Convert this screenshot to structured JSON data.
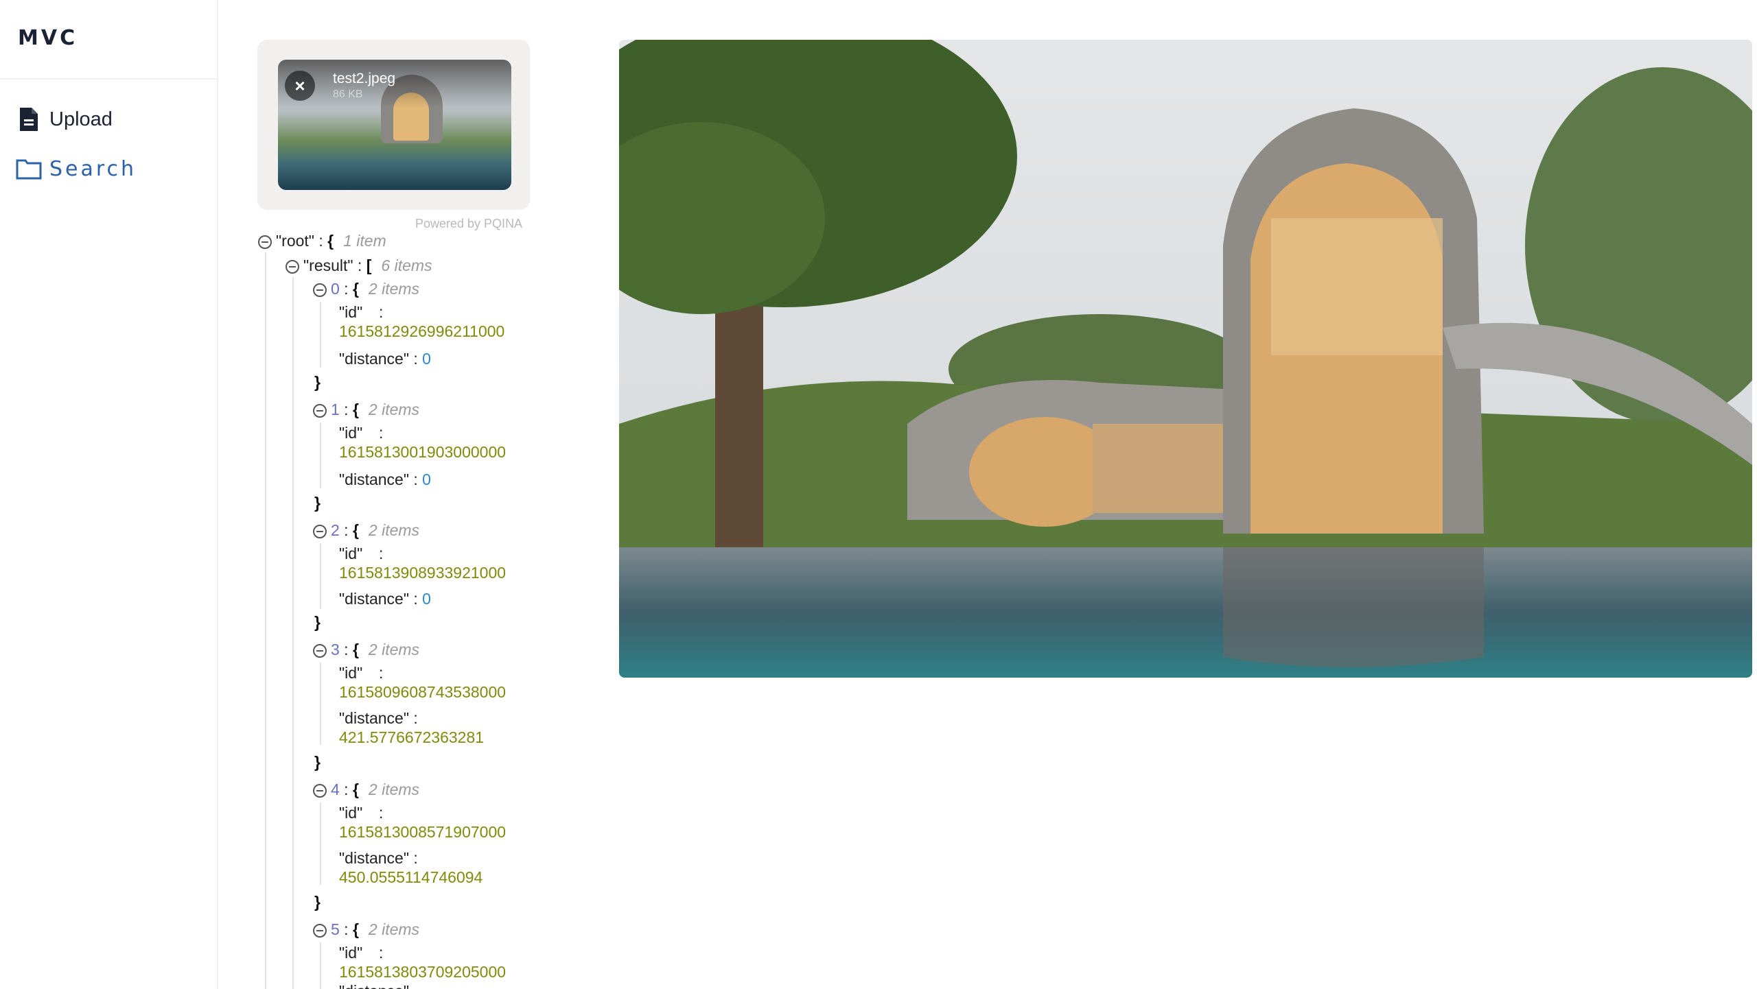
{
  "app": {
    "brand": "MVC"
  },
  "nav": [
    {
      "label": "Upload",
      "icon": "file-icon"
    },
    {
      "label": "Search",
      "icon": "folder-icon"
    }
  ],
  "upload": {
    "file_name": "test2.jpeg",
    "file_size": "86 KB",
    "credits": "Powered by PQINA"
  },
  "json_tree": {
    "root_key": "\"root\"",
    "root_count": "1 item",
    "result_key": "\"result\"",
    "result_count": "6 items",
    "entries": [
      {
        "index": "0",
        "count": "2 items",
        "id": "1615812926996211000",
        "distance": "0"
      },
      {
        "index": "1",
        "count": "2 items",
        "id": "1615813001903000000",
        "distance": "0"
      },
      {
        "index": "2",
        "count": "2 items",
        "id": "1615813908933921000",
        "distance": "0"
      },
      {
        "index": "3",
        "count": "2 items",
        "id": "1615809608743538000",
        "distance": "421.5776672363281"
      },
      {
        "index": "4",
        "count": "2 items",
        "id": "1615813008571907000",
        "distance": "450.0555114746094"
      },
      {
        "index": "5",
        "count": "2 items",
        "id": "1615813803709205000",
        "distance": ""
      }
    ],
    "id_key": "\"id\"",
    "distance_key": "\"distance\""
  },
  "colors": {
    "accent": "#2e62a8",
    "number_string": "#7d8c0b",
    "zero": "#2a87d0",
    "index": "#6a6fc7"
  }
}
